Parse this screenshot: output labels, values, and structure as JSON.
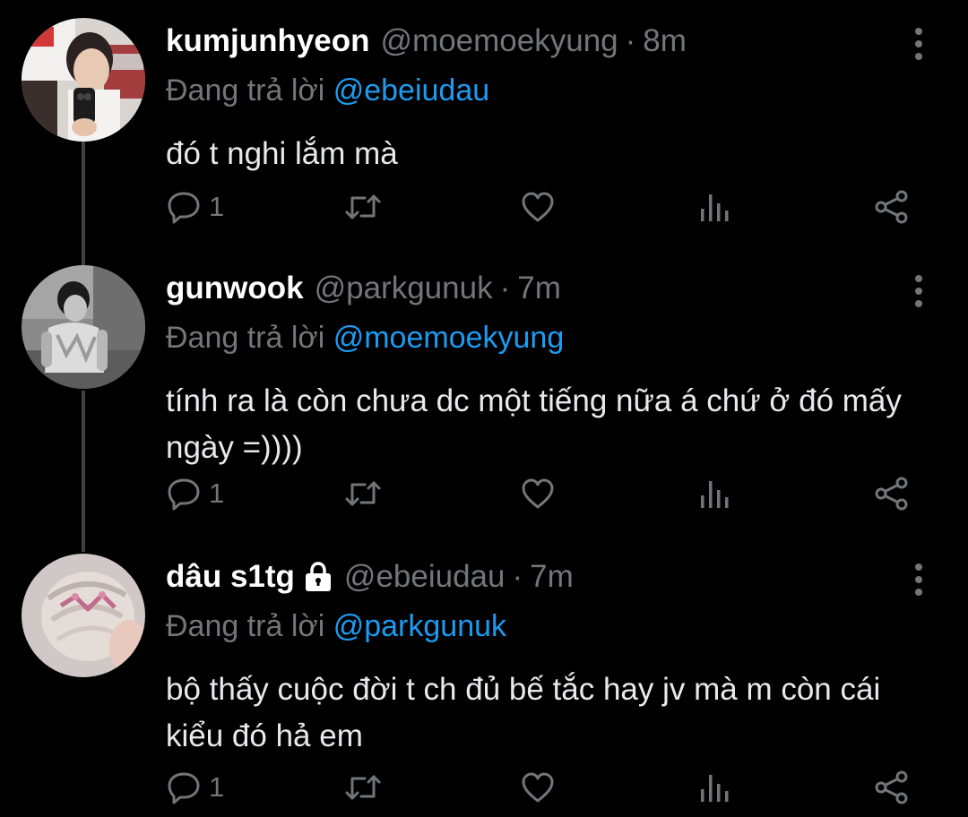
{
  "tweets": [
    {
      "display_name": "kumjunhyeon",
      "handle": "@moemoekyung",
      "separator": "·",
      "time": "8m",
      "replying_prefix": "Đang trả lời",
      "replying_to": "@ebeiudau",
      "text": "đó t nghi lắm mà",
      "reply_count": "1",
      "locked": false
    },
    {
      "display_name": "gunwook",
      "handle": "@parkgunuk",
      "separator": "·",
      "time": "7m",
      "replying_prefix": "Đang trả lời",
      "replying_to": "@moemoekyung",
      "text": "tính ra là còn chưa dc một tiếng nữa á chứ ở đó mấy ngày =))))",
      "reply_count": "1",
      "locked": false
    },
    {
      "display_name": "dâu s1tg",
      "handle": "@ebeiudau",
      "separator": "·",
      "time": "7m",
      "replying_prefix": "Đang trả lời",
      "replying_to": "@parkgunuk",
      "text": "bộ thấy cuộc đời t ch đủ bế tắc hay jv mà m còn cái kiểu đó hả em",
      "reply_count": "1",
      "locked": true
    }
  ],
  "colors": {
    "background": "#000000",
    "text": "#e7e9ea",
    "secondary": "#71767b",
    "link": "#1d9bf0",
    "thread_line": "#3e4144"
  },
  "icons": [
    "reply-icon",
    "retweet-icon",
    "like-icon",
    "views-icon",
    "share-icon",
    "more-icon",
    "lock-icon"
  ]
}
